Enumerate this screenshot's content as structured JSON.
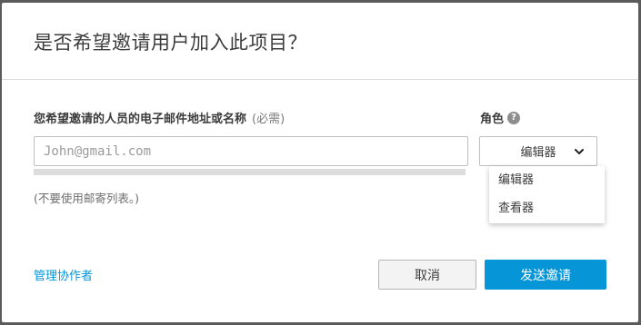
{
  "dialog": {
    "title": "是否希望邀请用户加入此项目？",
    "email": {
      "label": "您希望邀请的人员的电子邮件地址或名称",
      "required_label": "(必需)",
      "placeholder": "John@gmail.com",
      "value": "",
      "hint": "(不要使用邮寄列表。)"
    },
    "role": {
      "label": "角色",
      "help_icon": "question-circle-icon",
      "selected": "编辑器",
      "options": [
        "编辑器",
        "查看器"
      ]
    },
    "footer": {
      "manage_link": "管理协作者",
      "cancel": "取消",
      "send": "发送邀请"
    }
  },
  "colors": {
    "accent": "#0696d7",
    "backdrop": "#5b5b5b"
  }
}
